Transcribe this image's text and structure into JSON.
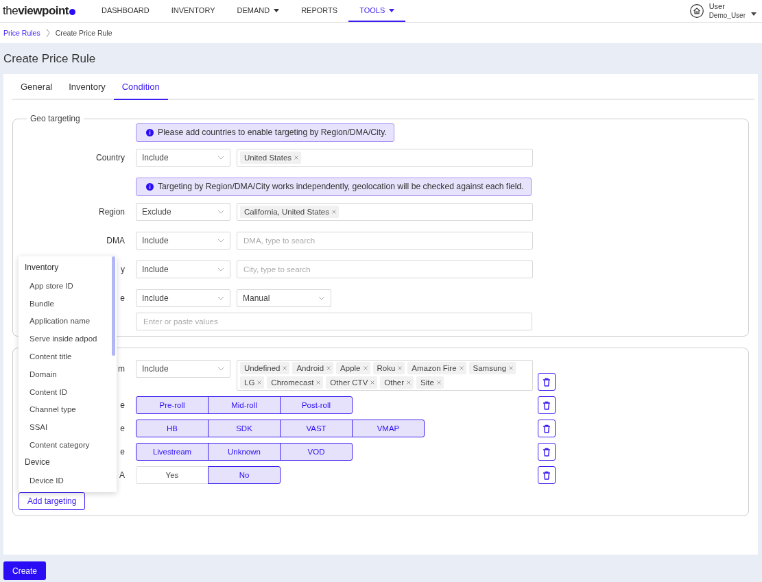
{
  "header": {
    "logo": "the**viewpoint**",
    "nav": [
      {
        "label": "DASHBOARD",
        "selected": false,
        "has_menu": false
      },
      {
        "label": "INVENTORY",
        "selected": false,
        "has_menu": false
      },
      {
        "label": "DEMAND",
        "selected": false,
        "has_menu": true
      },
      {
        "label": "REPORTS",
        "selected": false,
        "has_menu": false
      },
      {
        "label": "TOOLS",
        "selected": true,
        "has_menu": true
      }
    ],
    "user": {
      "name": "User",
      "account": "Demo_User"
    }
  },
  "breadcrumb": [
    {
      "label": "Price Rules",
      "kind": "link"
    },
    {
      "label": "Create Price Rule",
      "kind": "current"
    }
  ],
  "page_title": "Create Price Rule",
  "tabs": [
    {
      "label": "General",
      "selected": false
    },
    {
      "label": "Inventory",
      "selected": false
    },
    {
      "label": "Condition",
      "selected": true
    }
  ],
  "geo": {
    "legend": "Geo targeting",
    "rows": [
      {
        "kind": "notice",
        "text": "Please add countries to enable targeting by Region/DMA/City."
      },
      {
        "kind": "field",
        "label": "Country",
        "mode": "Include",
        "tags": [
          "United States"
        ]
      },
      {
        "kind": "notice",
        "text": "Targeting by Region/DMA/City works independently, geolocation will be checked against each field."
      },
      {
        "kind": "field",
        "label": "Region",
        "mode": "Exclude",
        "tags": [
          "California, United States"
        ]
      },
      {
        "kind": "field",
        "label": "DMA",
        "mode": "Include",
        "placeholder": "DMA, type to search"
      },
      {
        "kind": "field",
        "label": "y",
        "mode": "Include",
        "placeholder": "City, type to search"
      },
      {
        "kind": "select",
        "label": "e",
        "mode": "Include",
        "value": "Manual"
      },
      {
        "kind": "paste",
        "placeholder": "Enter or paste values"
      }
    ]
  },
  "targeting": {
    "rows": [
      {
        "kind": "field",
        "label": "m",
        "mode": "Include",
        "tags": [
          "Undefined",
          "Android",
          "Apple",
          "Roku",
          "Amazon Fire",
          "Samsung",
          "LG",
          "Chromecast",
          "Other CTV",
          "Other",
          "Site"
        ]
      },
      {
        "kind": "segments",
        "label": "e",
        "options": [
          {
            "label": "Pre-roll",
            "selected": true
          },
          {
            "label": "Mid-roll",
            "selected": true
          },
          {
            "label": "Post-roll",
            "selected": true
          }
        ]
      },
      {
        "kind": "segments",
        "label": "e",
        "options": [
          {
            "label": "HB",
            "selected": true
          },
          {
            "label": "SDK",
            "selected": true
          },
          {
            "label": "VAST",
            "selected": true
          },
          {
            "label": "VMAP",
            "selected": true
          }
        ]
      },
      {
        "kind": "segments",
        "label": "e",
        "options": [
          {
            "label": "Livestream",
            "selected": true
          },
          {
            "label": "Unknown",
            "selected": true
          },
          {
            "label": "VOD",
            "selected": true
          }
        ]
      },
      {
        "kind": "segments",
        "label": "A",
        "options": [
          {
            "label": "Yes",
            "selected": false
          },
          {
            "label": "No",
            "selected": true
          }
        ]
      }
    ],
    "add_button": "Add targeting"
  },
  "menu": {
    "items": [
      {
        "kind": "group",
        "label": "Inventory"
      },
      {
        "kind": "option",
        "label": "App store ID"
      },
      {
        "kind": "option",
        "label": "Bundle"
      },
      {
        "kind": "option",
        "label": "Application name"
      },
      {
        "kind": "option",
        "label": "Serve inside adpod"
      },
      {
        "kind": "option",
        "label": "Content title"
      },
      {
        "kind": "option",
        "label": "Domain"
      },
      {
        "kind": "option",
        "label": "Content ID"
      },
      {
        "kind": "option",
        "label": "Channel type"
      },
      {
        "kind": "option",
        "label": "SSAI"
      },
      {
        "kind": "option",
        "label": "Content category"
      },
      {
        "kind": "group",
        "label": "Device"
      },
      {
        "kind": "option",
        "label": "Device ID"
      }
    ]
  },
  "create_button": "Create"
}
